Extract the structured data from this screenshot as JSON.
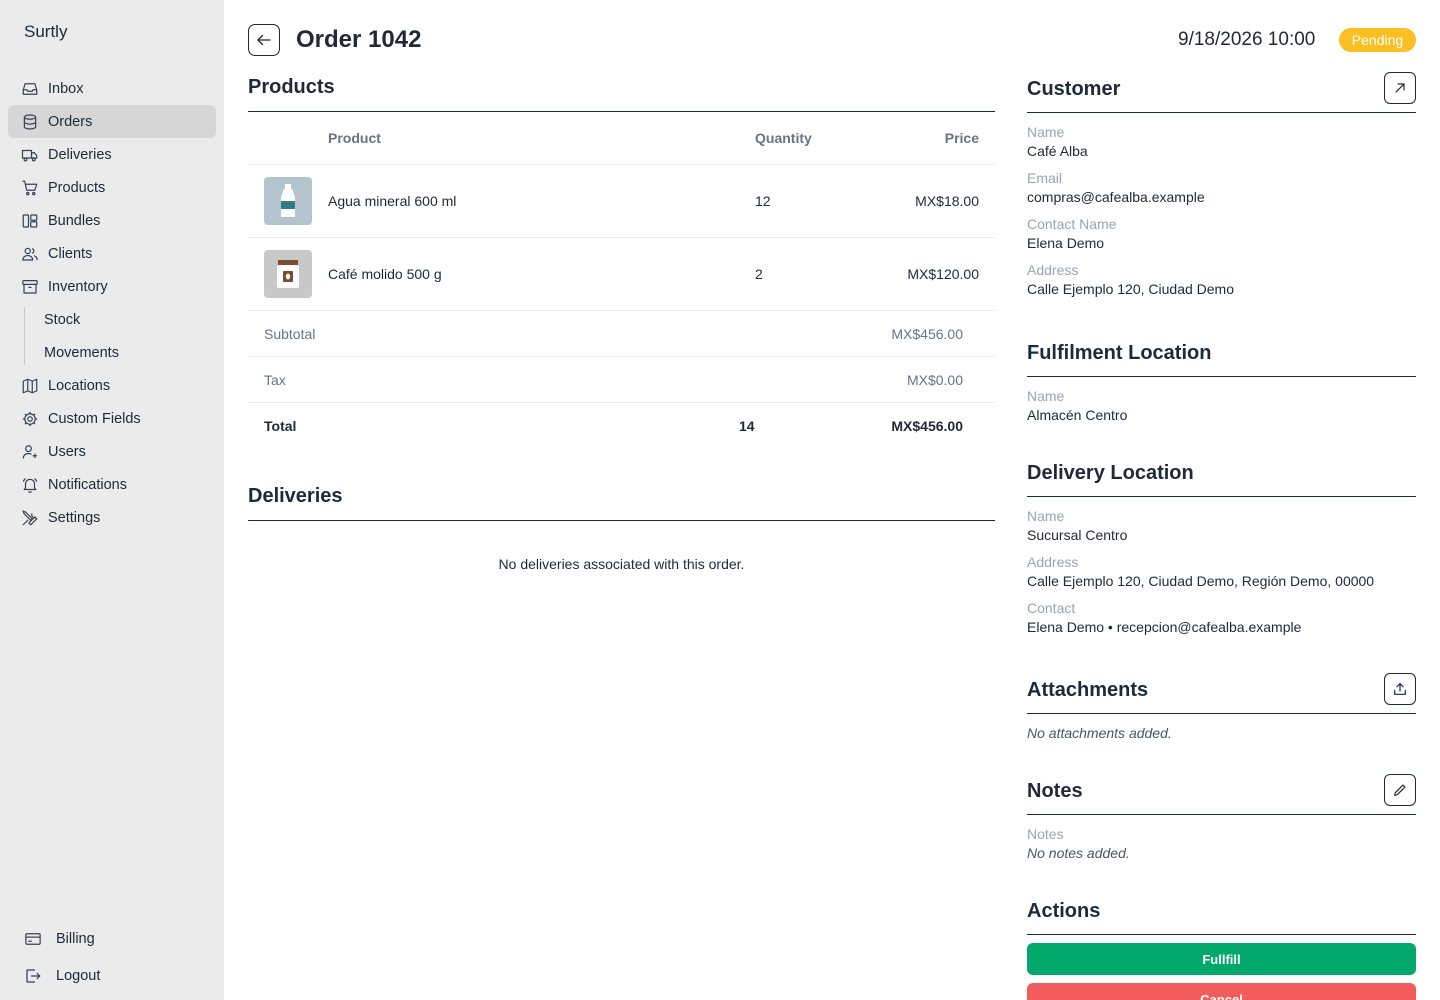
{
  "app": {
    "name": "Surtly"
  },
  "sidebar": {
    "items": [
      {
        "label": "Inbox",
        "icon": "inbox-icon"
      },
      {
        "label": "Orders",
        "icon": "database-icon",
        "active": true
      },
      {
        "label": "Deliveries",
        "icon": "truck-icon"
      },
      {
        "label": "Products",
        "icon": "cart-icon"
      },
      {
        "label": "Bundles",
        "icon": "bundles-icon"
      },
      {
        "label": "Clients",
        "icon": "users-icon"
      },
      {
        "label": "Inventory",
        "icon": "archive-icon"
      }
    ],
    "sub_items": [
      {
        "label": "Stock"
      },
      {
        "label": "Movements"
      }
    ],
    "items2": [
      {
        "label": "Locations",
        "icon": "map-icon"
      },
      {
        "label": "Custom Fields",
        "icon": "cog-icon"
      },
      {
        "label": "Users",
        "icon": "user-plus-icon"
      },
      {
        "label": "Notifications",
        "icon": "bell-icon"
      },
      {
        "label": "Settings",
        "icon": "tools-icon"
      }
    ],
    "bottom": [
      {
        "label": "Billing",
        "icon": "credit-card-icon"
      },
      {
        "label": "Logout",
        "icon": "logout-icon"
      }
    ]
  },
  "header": {
    "title": "Order 1042",
    "datetime": "9/18/2026 10:00",
    "status": "Pending",
    "status_color": "#fbbf24"
  },
  "products": {
    "title": "Products",
    "columns": {
      "product": "Product",
      "quantity": "Quantity",
      "price": "Price"
    },
    "rows": [
      {
        "name": "Agua mineral 600 ml",
        "quantity": "12",
        "price": "MX$18.00",
        "thumb": "water-bottle-icon"
      },
      {
        "name": "Café molido 500 g",
        "quantity": "2",
        "price": "MX$120.00",
        "thumb": "coffee-bag-icon"
      }
    ],
    "subtotal_label": "Subtotal",
    "subtotal": "MX$456.00",
    "tax_label": "Tax",
    "tax": "MX$0.00",
    "total_label": "Total",
    "total_qty": "14",
    "total": "MX$456.00"
  },
  "deliveries": {
    "title": "Deliveries",
    "empty": "No deliveries associated with this order."
  },
  "customer": {
    "title": "Customer",
    "name_label": "Name",
    "name": "Café Alba",
    "email_label": "Email",
    "email": "compras@cafealba.example",
    "contact_label": "Contact Name",
    "contact": "Elena Demo",
    "address_label": "Address",
    "address": "Calle Ejemplo 120, Ciudad Demo"
  },
  "fulfilment": {
    "title": "Fulfilment Location",
    "name_label": "Name",
    "name": "Almacén Centro"
  },
  "delivery_location": {
    "title": "Delivery Location",
    "name_label": "Name",
    "name": "Sucursal Centro",
    "address_label": "Address",
    "address": "Calle Ejemplo 120, Ciudad Demo, Región Demo, 00000",
    "contact_label": "Contact",
    "contact": "Elena Demo • recepcion@cafealba.example"
  },
  "attachments": {
    "title": "Attachments",
    "empty": "No attachments added."
  },
  "notes": {
    "title": "Notes",
    "label": "Notes",
    "empty": "No notes added."
  },
  "actions": {
    "title": "Actions",
    "fulfill": "Fullfill",
    "cancel": "Cancel",
    "fulfill_color": "#00a86b",
    "cancel_color": "#f25c5c"
  }
}
